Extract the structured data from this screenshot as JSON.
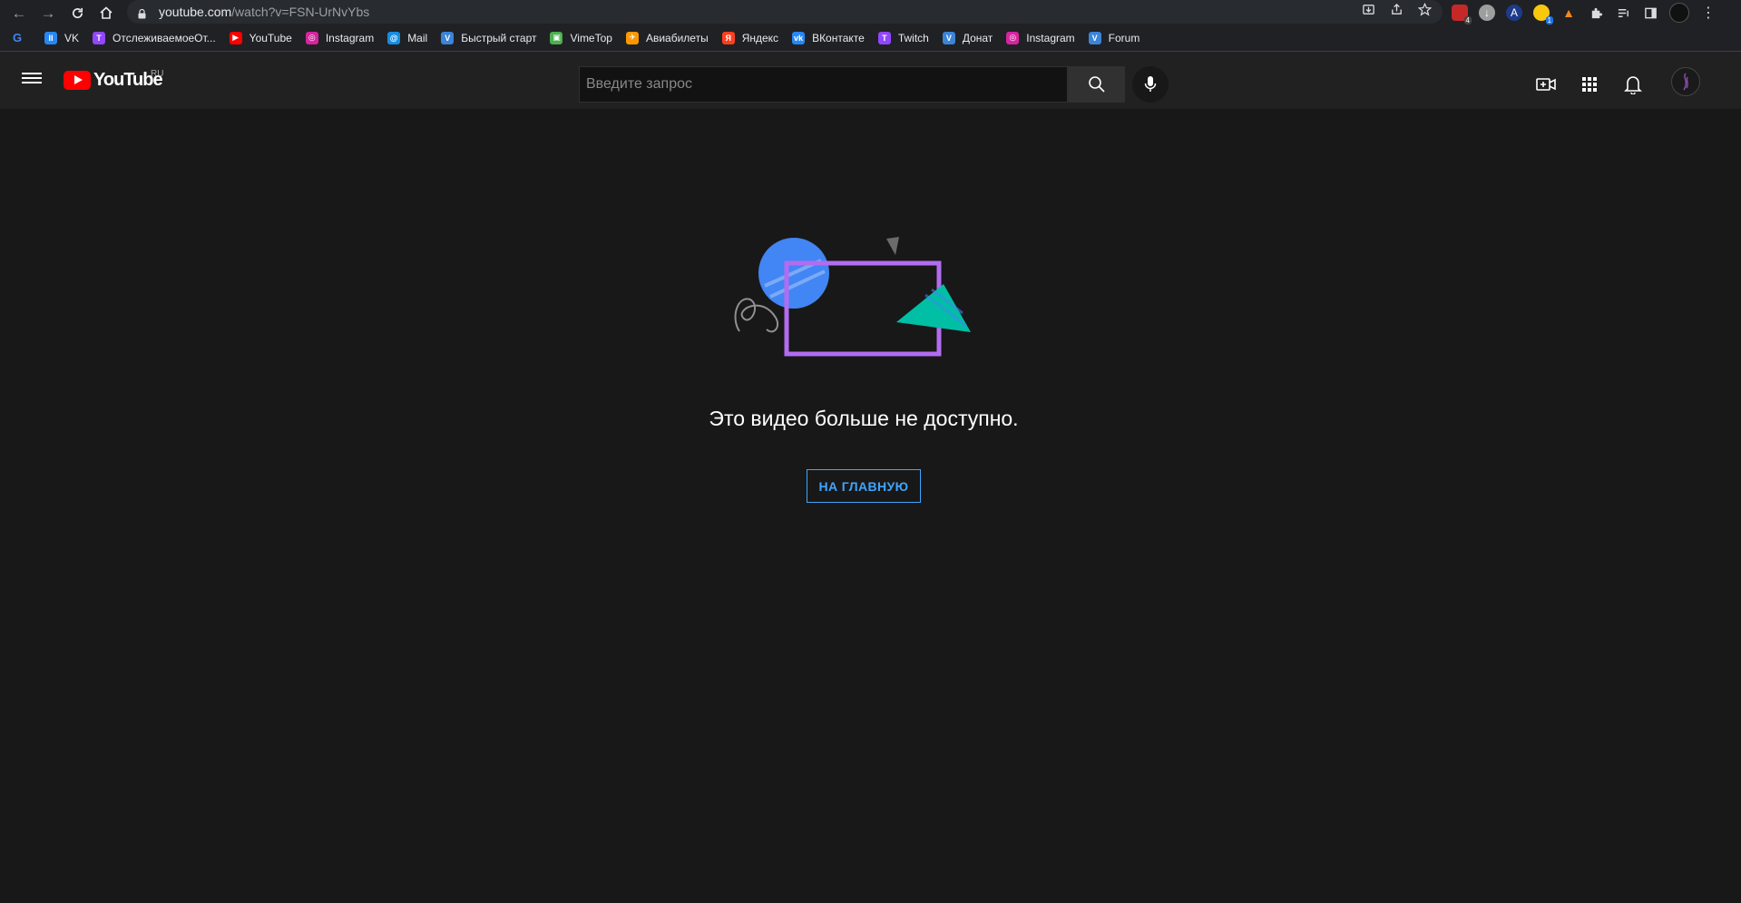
{
  "browser": {
    "url_host": "youtube.com",
    "url_path": "/watch?v=FSN-UrNvYbs",
    "extension_badges": {
      "first": "4",
      "second": "1"
    }
  },
  "bookmarks": [
    {
      "label": "",
      "icon": "google-icon",
      "color": "#ffffff"
    },
    {
      "label": "VK",
      "icon": "vk-pause-icon",
      "color": "#2787f5"
    },
    {
      "label": "ОтслеживаемоеОт...",
      "icon": "twitch-icon",
      "color": "#9146ff"
    },
    {
      "label": "YouTube",
      "icon": "youtube-icon",
      "color": "#ff0000"
    },
    {
      "label": "Instagram",
      "icon": "instagram-icon",
      "color": "#d6249f"
    },
    {
      "label": "Mail",
      "icon": "mail-icon",
      "color": "#168de2"
    },
    {
      "label": "Быстрый старт",
      "icon": "vivaldi-icon",
      "color": "#3b84d8"
    },
    {
      "label": "VimeTop",
      "icon": "creeper-icon",
      "color": "#4caf50"
    },
    {
      "label": "Авиабилеты",
      "icon": "tickets-icon",
      "color": "#ff9800"
    },
    {
      "label": "Яндекс",
      "icon": "yandex-icon",
      "color": "#fc3f1d"
    },
    {
      "label": "ВКонтакте",
      "icon": "vk-icon",
      "color": "#2787f5"
    },
    {
      "label": "Twitch",
      "icon": "twitch-icon",
      "color": "#9146ff"
    },
    {
      "label": "Донат",
      "icon": "vivaldi-icon",
      "color": "#3b84d8"
    },
    {
      "label": "Instagram",
      "icon": "instagram-icon",
      "color": "#d6249f"
    },
    {
      "label": "Forum",
      "icon": "vivaldi-icon",
      "color": "#3b84d8"
    }
  ],
  "masthead": {
    "logo_text": "YouTube",
    "region": "RU",
    "search_placeholder": "Введите запрос"
  },
  "error": {
    "message": "Это видео больше не доступно.",
    "button_label": "НА ГЛАВНУЮ"
  },
  "colors": {
    "accent": "#3ea6ff",
    "background": "#181818",
    "masthead": "#212121",
    "illustration_circle": "#4285f4",
    "illustration_frame": "#b26cf0",
    "illustration_triangle": "#00bfa5"
  }
}
